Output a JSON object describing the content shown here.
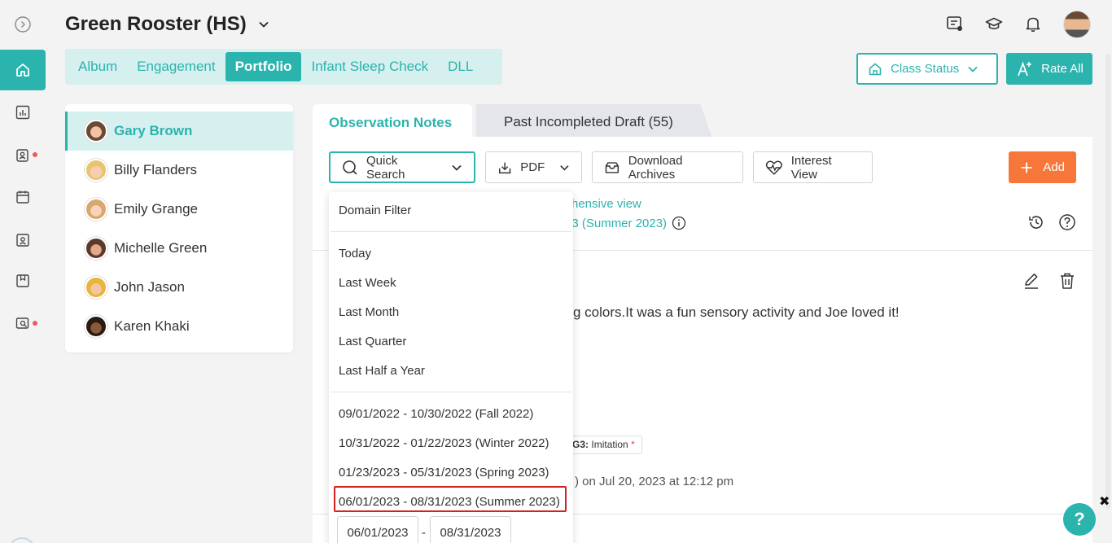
{
  "header": {
    "title": "Green Rooster (HS)"
  },
  "tabs": [
    {
      "label": "Album",
      "active": false
    },
    {
      "label": "Engagement",
      "active": false
    },
    {
      "label": "Portfolio",
      "active": true
    },
    {
      "label": "Infant Sleep Check",
      "active": false
    },
    {
      "label": "DLL",
      "active": false
    }
  ],
  "actions": {
    "class_status": "Class Status",
    "rate_all": "Rate All"
  },
  "children": [
    {
      "name": "Gary Brown",
      "selected": true
    },
    {
      "name": "Billy Flanders",
      "selected": false
    },
    {
      "name": "Emily Grange",
      "selected": false
    },
    {
      "name": "Michelle Green",
      "selected": false
    },
    {
      "name": "John Jason",
      "selected": false
    },
    {
      "name": "Karen Khaki",
      "selected": false
    }
  ],
  "panel": {
    "tab_active": "Observation Notes",
    "tab_other": "Past Incompleted Draft (55)",
    "toolbar": {
      "quick_search": "Quick Search",
      "pdf": "PDF",
      "download_archives": "Download Archives",
      "interest_view": "Interest View",
      "add": "Add"
    },
    "comprehensive_view": "hensive view",
    "period": "23 (Summer 2023)",
    "note_text": "g colors.It was a fun sensory activity and Joe loved it!",
    "domain_tag": {
      "code": "G3:",
      "label": "Imitation",
      "required": "*"
    },
    "meta": ") on Jul 20, 2023 at 12:12 pm"
  },
  "dropdown": {
    "domain_filter": "Domain Filter",
    "relative": [
      "Today",
      "Last Week",
      "Last Month",
      "Last Quarter",
      "Last Half a Year"
    ],
    "seasons": [
      "09/01/2022 - 10/30/2022 (Fall 2022)",
      "10/31/2022 - 01/22/2023 (Winter 2022)",
      "01/23/2023 - 05/31/2023 (Spring 2023)",
      "06/01/2023 - 08/31/2023 (Summer 2023)"
    ],
    "selected_season_index": 3,
    "start_date": "06/01/2023",
    "end_date": "08/31/2023",
    "date_separator": "-"
  },
  "help": {
    "label": "?"
  },
  "close": {
    "label": "✖"
  },
  "colors": {
    "accent": "#2bb3ad",
    "accent_light": "#d6f0ef",
    "add": "#f7773a",
    "highlight": "#d32020",
    "dot": "#f05a5a"
  }
}
